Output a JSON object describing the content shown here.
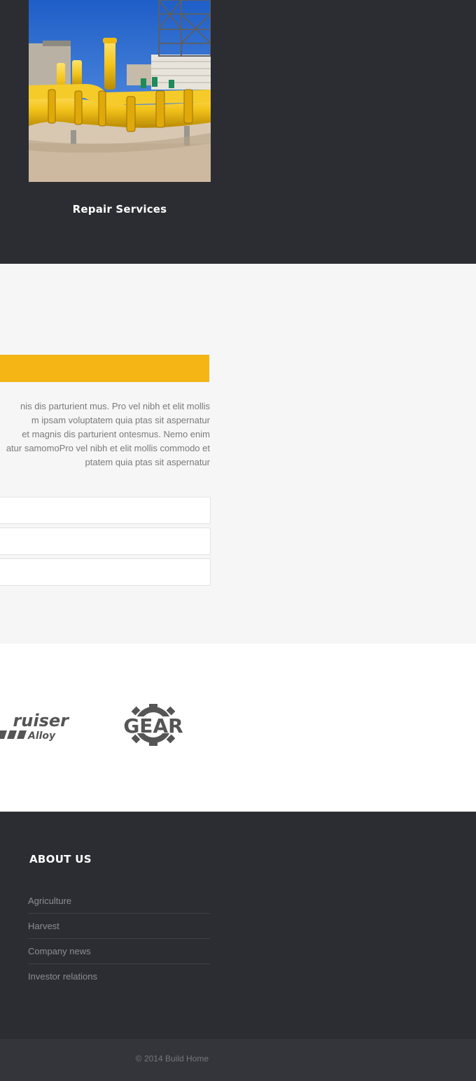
{
  "services": {
    "items": [
      {
        "title": "Repair Services",
        "image": "industrial-yellow-pipelines-photo"
      }
    ]
  },
  "content": {
    "paragraph_lines": [
      "nis dis parturient mus. Pro vel nibh et elit mollis",
      "m ipsam voluptatem quia ptas sit aspernatur",
      "et magnis dis parturient ontesmus. Nemo enim",
      "atur samomoPro vel nibh et elit mollis commodo et",
      "ptatem quia ptas sit aspernatur"
    ],
    "accent_color": "#f4b515"
  },
  "logos": {
    "cruiser": {
      "word1": "ruiser",
      "word2": "Alloy"
    },
    "gear": {
      "text": "GEAR"
    }
  },
  "footer": {
    "heading": "ABOUT US",
    "links": [
      "Agriculture",
      "Harvest",
      "Company news",
      "Investor relations"
    ]
  },
  "copyright": "© 2014 Build Home"
}
